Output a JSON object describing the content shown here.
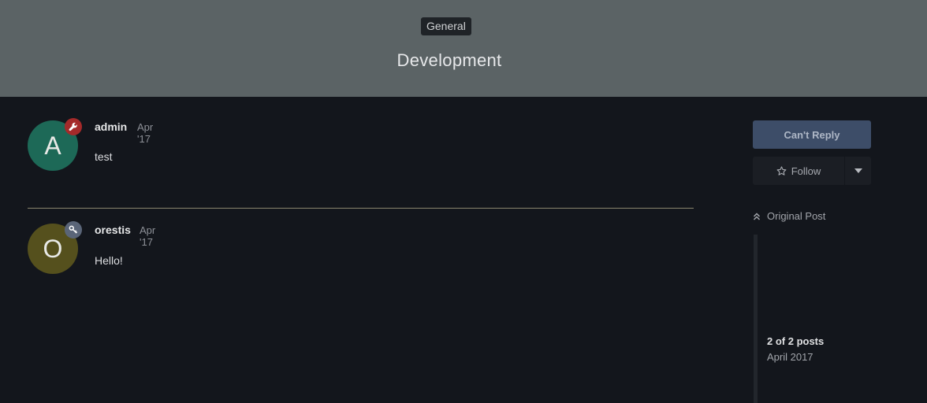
{
  "topic": {
    "category": "General",
    "title": "Development"
  },
  "posts": [
    {
      "avatar_letter": "A",
      "avatar_color": "#1d6957",
      "badge": "wrench-icon",
      "badge_color": "#a52a2a",
      "author": "admin",
      "date": "Apr '17",
      "body": "test"
    },
    {
      "avatar_letter": "O",
      "avatar_color": "#55501d",
      "badge": "key-icon",
      "badge_color": "#5a6578",
      "author": "orestis",
      "date": "Apr '17",
      "body": "Hello!"
    }
  ],
  "actions": {
    "reply_label": "Can't Reply",
    "follow_label": "Follow"
  },
  "timeline": {
    "original_post_label": "Original Post",
    "progress": "2 of 2 posts",
    "current_date": "April 2017"
  },
  "colors": {
    "header_bg": "#5b6365",
    "page_bg": "#13161c",
    "reply_button_bg": "#3d4d68"
  }
}
